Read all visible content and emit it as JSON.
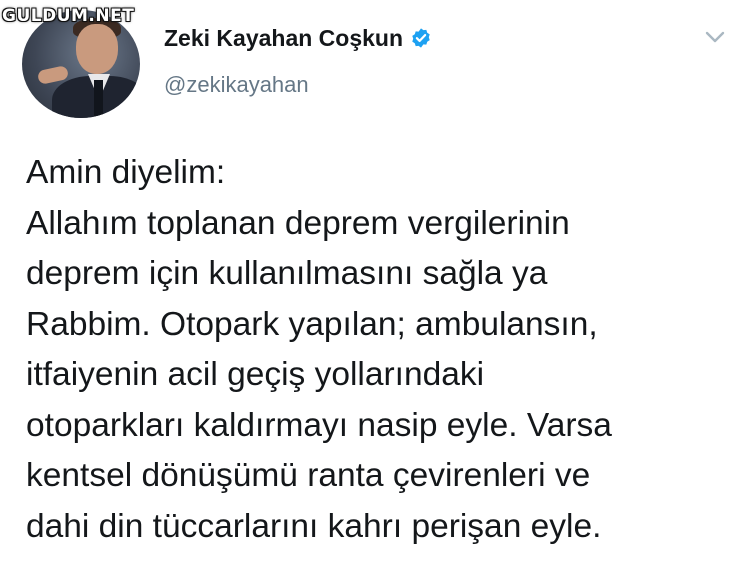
{
  "watermark": "GULDUM.NET",
  "tweet": {
    "author": {
      "display_name": "Zeki Kayahan Coşkun",
      "handle": "@zekikayahan",
      "verified": true
    },
    "text": "Amin diyelim:\nAllahım toplanan deprem vergilerinin\ndeprem için kullanılmasını sağla ya\nRabbim. Otopark yapılan; ambulansın,\nitfaiyenin acil geçiş yollarındaki\notoparkları kaldırmayı nasip eyle. Varsa\nkentsel dönüşümü ranta çevirenleri ve\ndahi din tüccarlarını kahrı perişan eyle."
  },
  "icons": {
    "verified": "verified-badge-icon",
    "menu": "chevron-down-icon"
  },
  "colors": {
    "verified_blue": "#1da1f2",
    "text": "#14171a",
    "handle": "#657786",
    "chevron": "#aab8c2"
  }
}
